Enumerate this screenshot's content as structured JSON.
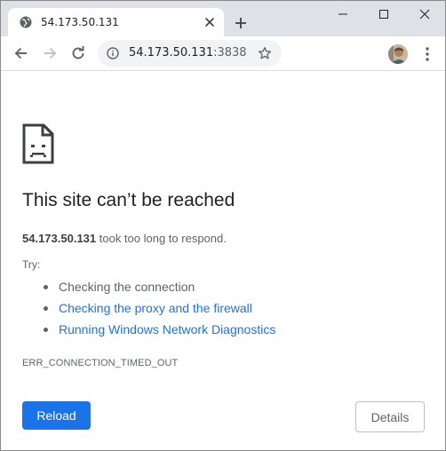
{
  "tab": {
    "title": "54.173.50.131"
  },
  "omnibox": {
    "host": "54.173.50.131",
    "port": ":3838"
  },
  "error": {
    "headline": "This site can’t be reached",
    "host_bold": "54.173.50.131",
    "description": " took too long to respond.",
    "try_label": "Try:",
    "suggestions": [
      {
        "label": "Checking the connection",
        "link": false
      },
      {
        "label": "Checking the proxy and the firewall",
        "link": true
      },
      {
        "label": "Running Windows Network Diagnostics",
        "link": true
      }
    ],
    "code": "ERR_CONNECTION_TIMED_OUT"
  },
  "buttons": {
    "reload": "Reload",
    "details": "Details"
  },
  "colors": {
    "accent": "#1a73e8",
    "tabstrip": "#dee1e6",
    "text_secondary": "#5f6368"
  },
  "icons": [
    "globe-icon",
    "close-icon",
    "plus-icon",
    "minimize-icon",
    "maximize-icon",
    "back-arrow-icon",
    "forward-arrow-icon",
    "reload-icon",
    "info-icon",
    "star-icon",
    "avatar",
    "more-vert-icon",
    "sad-page-icon"
  ]
}
